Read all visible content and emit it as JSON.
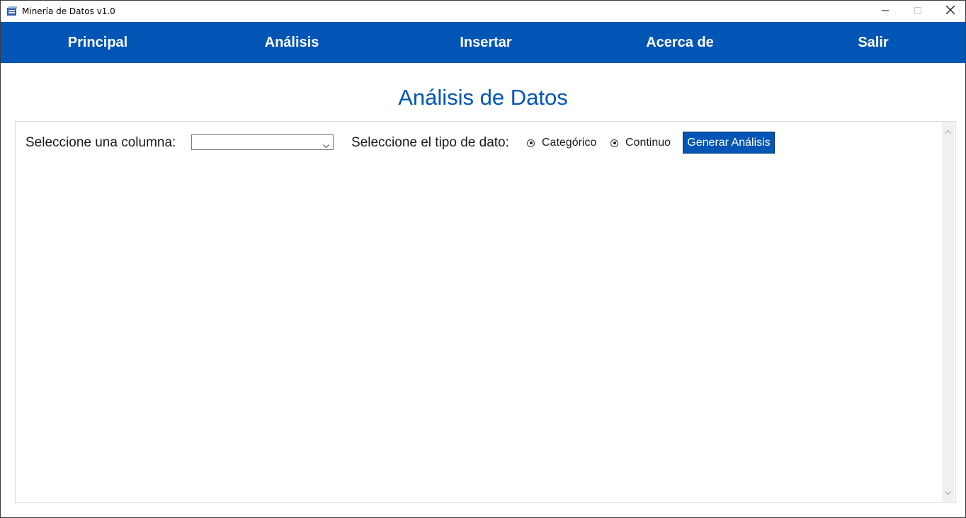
{
  "window": {
    "title": "Minería de Datos v1.0",
    "icon": "database-app-icon"
  },
  "menu": {
    "items": [
      "Principal",
      "Análisis",
      "Insertar",
      "Acerca de",
      "Salir"
    ]
  },
  "page": {
    "title": "Análisis de Datos"
  },
  "form": {
    "column_label": "Seleccione una columna:",
    "column_value": "",
    "type_label": "Seleccione el tipo de dato:",
    "options": [
      "Categórico",
      "Continuo"
    ],
    "generate_label": "Generar Análisis"
  },
  "colors": {
    "accent": "#0155b4",
    "menu_text": "#ffffff"
  }
}
